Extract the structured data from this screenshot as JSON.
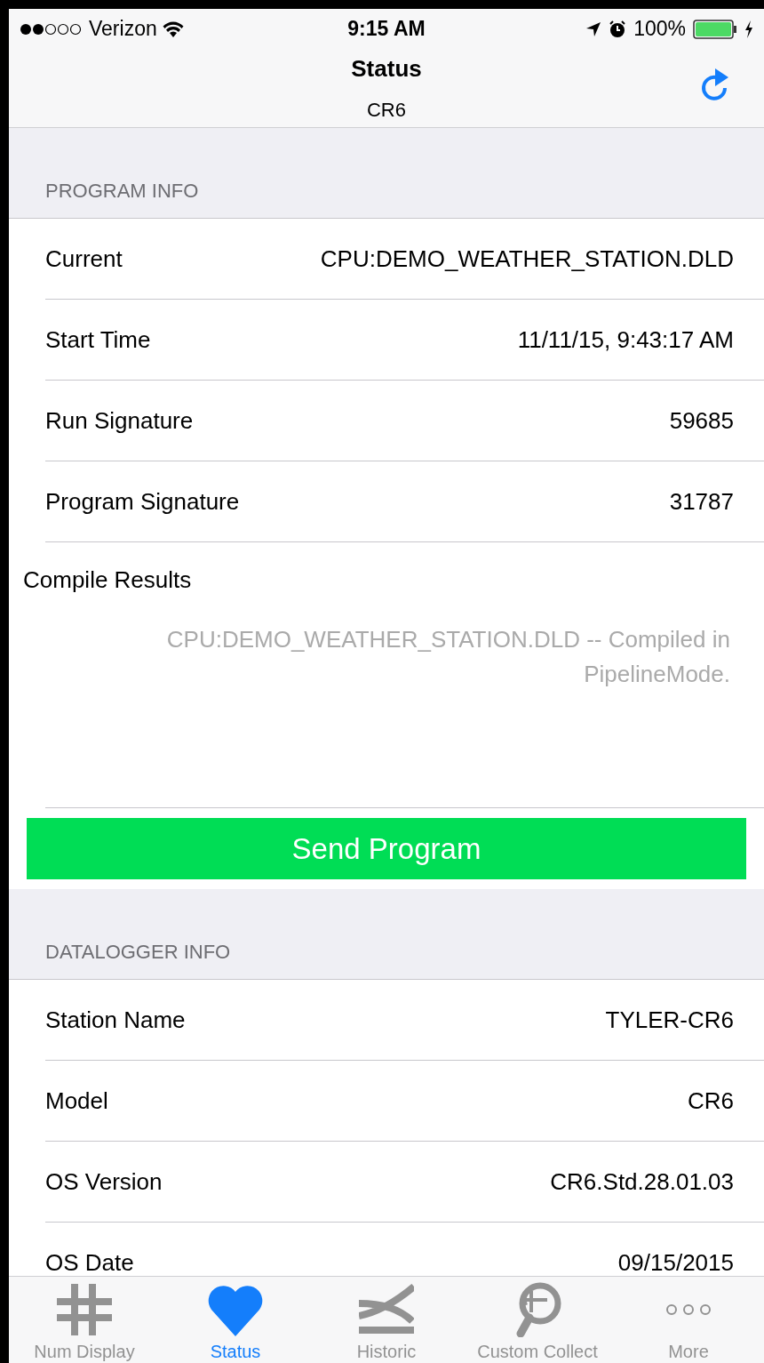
{
  "status_bar": {
    "carrier": "Verizon",
    "time": "9:15 AM",
    "battery": "100%"
  },
  "nav": {
    "title": "Status",
    "subtitle": "CR6"
  },
  "program_info": {
    "header": "PROGRAM INFO",
    "rows": [
      {
        "label": "Current",
        "value": "CPU:DEMO_WEATHER_STATION.DLD"
      },
      {
        "label": "Start Time",
        "value": "11/11/15, 9:43:17 AM"
      },
      {
        "label": "Run Signature",
        "value": "59685"
      },
      {
        "label": "Program Signature",
        "value": "31787"
      }
    ],
    "compile_label": "Compile Results",
    "compile_text": "CPU:DEMO_WEATHER_STATION.DLD -- Compiled in PipelineMode.",
    "button": "Send Program"
  },
  "datalogger_info": {
    "header": "DATALOGGER INFO",
    "rows": [
      {
        "label": "Station Name",
        "value": "TYLER-CR6"
      },
      {
        "label": "Model",
        "value": "CR6"
      },
      {
        "label": "OS Version",
        "value": "CR6.Std.28.01.03"
      },
      {
        "label": "OS Date",
        "value": "09/15/2015"
      }
    ]
  },
  "tabs": [
    {
      "label": "Num Display",
      "selected": false
    },
    {
      "label": "Status",
      "selected": true
    },
    {
      "label": "Historic",
      "selected": false
    },
    {
      "label": "Custom Collect",
      "selected": false
    },
    {
      "label": "More",
      "selected": false
    }
  ]
}
